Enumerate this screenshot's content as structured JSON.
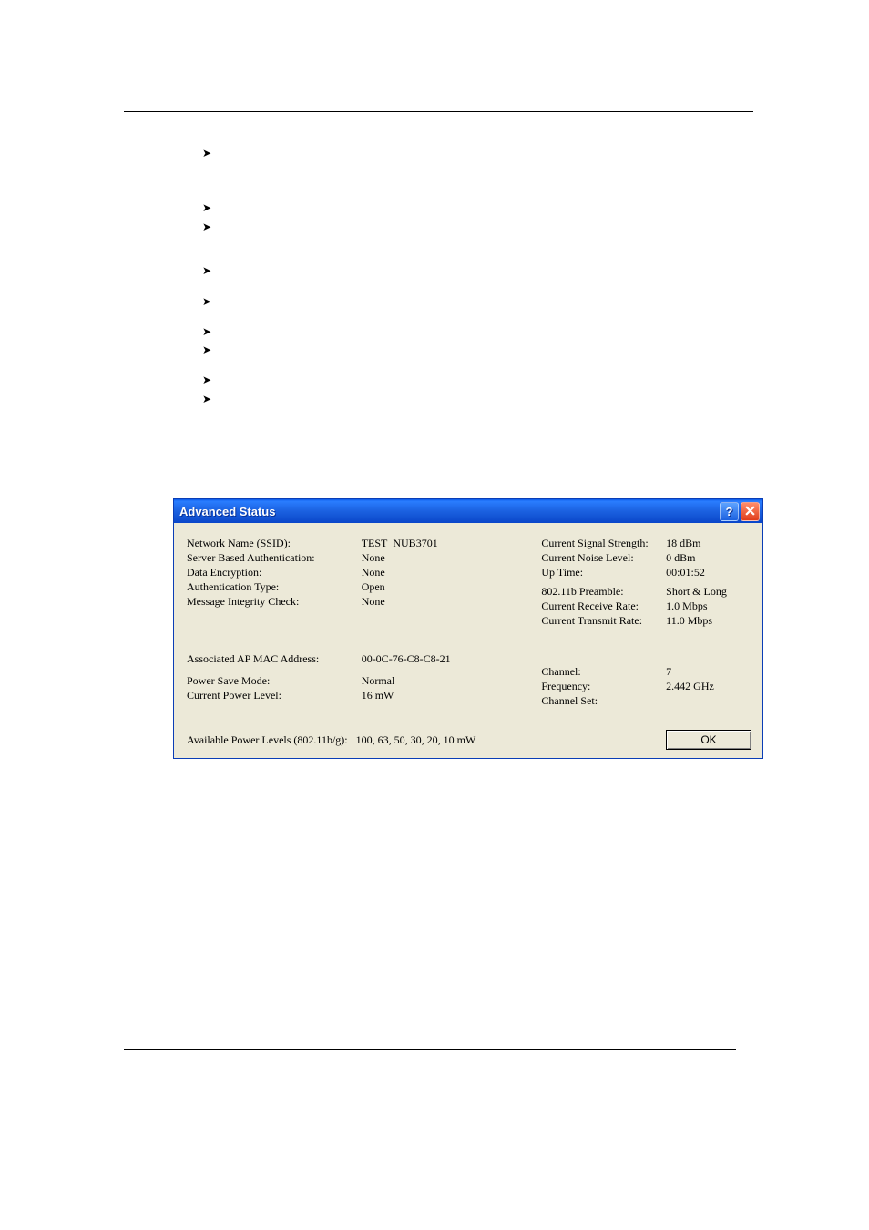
{
  "dialog": {
    "title": "Advanced Status",
    "left": {
      "network_name_label": "Network Name (SSID):",
      "network_name_value": "TEST_NUB3701",
      "server_auth_label": "Server Based Authentication:",
      "server_auth_value": "None",
      "data_encryption_label": "Data Encryption:",
      "data_encryption_value": "None",
      "auth_type_label": "Authentication Type:",
      "auth_type_value": "Open",
      "msg_integrity_label": "Message Integrity Check:",
      "msg_integrity_value": "None",
      "assoc_ap_mac_label": "Associated AP MAC Address:",
      "assoc_ap_mac_value": "00-0C-76-C8-C8-21",
      "power_save_label": "Power Save Mode:",
      "power_save_value": "Normal",
      "cur_power_label": "Current Power Level:",
      "cur_power_value": "16 mW",
      "available_power_label": "Available Power Levels (802.11b/g):",
      "available_power_value": "100, 63, 50, 30, 20, 10 mW"
    },
    "right": {
      "signal_strength_label": "Current Signal Strength:",
      "signal_strength_value": "18 dBm",
      "noise_level_label": "Current Noise Level:",
      "noise_level_value": "0 dBm",
      "uptime_label": "Up Time:",
      "uptime_value": "00:01:52",
      "preamble_label": "802.11b Preamble:",
      "preamble_value": "Short & Long",
      "rx_rate_label": "Current Receive Rate:",
      "rx_rate_value": "1.0 Mbps",
      "tx_rate_label": "Current Transmit Rate:",
      "tx_rate_value": "11.0 Mbps",
      "channel_label": "Channel:",
      "channel_value": "7",
      "frequency_label": "Frequency:",
      "frequency_value": "2.442 GHz",
      "channel_set_label": "Channel Set:",
      "channel_set_value": ""
    },
    "ok_button": "OK"
  },
  "bullet_glyph": "➤"
}
